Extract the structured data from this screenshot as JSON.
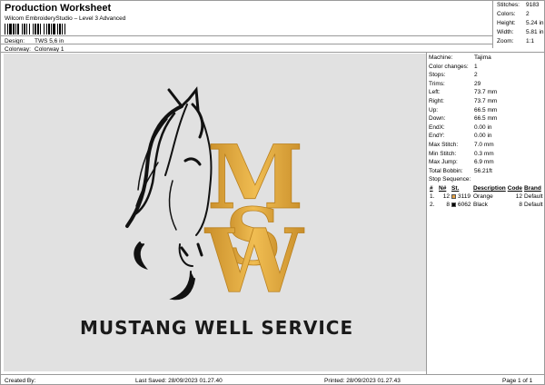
{
  "header": {
    "title": "Production Worksheet",
    "subtitle": "Wilcom EmbroideryStudio – Level 3 Advanced",
    "design_label": "Design:",
    "design_value": "TWS 5,6 in",
    "colorway_label": "Colorway:",
    "colorway_value": "Colorway 1"
  },
  "top_stats": [
    {
      "label": "Stitches:",
      "value": "9183"
    },
    {
      "label": "Colors:",
      "value": "2"
    },
    {
      "label": "Height:",
      "value": "5.24 in"
    },
    {
      "label": "Width:",
      "value": "5.81 in"
    },
    {
      "label": "Zoom:",
      "value": "1:1"
    }
  ],
  "design": {
    "brand_text": "MUSTANG WELL SERVICE",
    "colors": {
      "gold": "#e7ad3d",
      "gold_dark": "#b9801f",
      "black": "#111111",
      "background": "#e1e1e1"
    }
  },
  "info": [
    {
      "label": "Machine:",
      "value": "Tajima"
    },
    {
      "label": "Color changes:",
      "value": "1"
    },
    {
      "label": "Stops:",
      "value": "2"
    },
    {
      "label": "Trims:",
      "value": "29"
    },
    {
      "label": "Left:",
      "value": "73.7 mm"
    },
    {
      "label": "Right:",
      "value": "73.7 mm"
    },
    {
      "label": "Up:",
      "value": "66.5 mm"
    },
    {
      "label": "Down:",
      "value": "66.5 mm"
    },
    {
      "label": "EndX:",
      "value": "0.00 in"
    },
    {
      "label": "EndY:",
      "value": "0.00 in"
    },
    {
      "label": "Max Stitch:",
      "value": "7.0 mm"
    },
    {
      "label": "Min Stitch:",
      "value": "0.3 mm"
    },
    {
      "label": "Max Jump:",
      "value": "6.9 mm"
    },
    {
      "label": "Total Bobbin:",
      "value": "56.21ft"
    }
  ],
  "stop_sequence": {
    "title": "Stop Sequence:",
    "headers": [
      "#",
      "N#",
      "St.",
      "Description",
      "Code",
      "Brand"
    ],
    "rows": [
      {
        "num": "1.",
        "needle": "12",
        "color": "#e6a245",
        "st": "3119",
        "description": "Orange",
        "code": "12",
        "brand": "Default"
      },
      {
        "num": "2.",
        "needle": "8",
        "color": "#000000",
        "st": "6062",
        "description": "Black",
        "code": "8",
        "brand": "Default"
      }
    ]
  },
  "footer": {
    "created_by": "Created By:",
    "last_saved": "Last Saved: 28/09/2023 01.27.40",
    "printed": "Printed: 28/09/2023 01.27.43",
    "page": "Page 1 of 1"
  }
}
